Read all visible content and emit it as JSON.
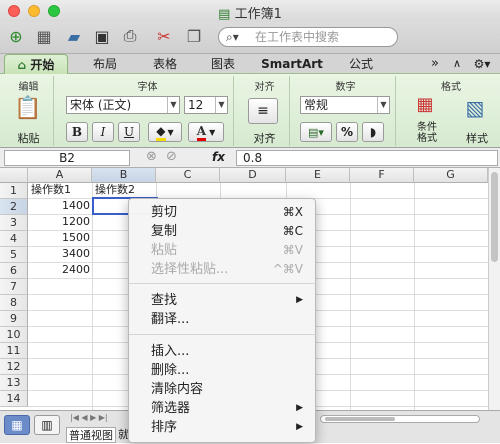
{
  "window": {
    "title": "工作簿1"
  },
  "toolbar": {
    "search_placeholder": "在工作表中搜索"
  },
  "tabs": [
    "开始",
    "布局",
    "表格",
    "图表",
    "SmartArt",
    "公式"
  ],
  "ribbon": {
    "groups": {
      "edit": "编辑",
      "font": "字体",
      "align": "对齐",
      "number": "数字",
      "format": "格式"
    },
    "paste": "粘贴",
    "font_name": "宋体 (正文)",
    "font_size": "12",
    "bold": "B",
    "italic": "I",
    "underline": "U",
    "font_color": "A",
    "align_label": "对齐",
    "number_format": "常规",
    "percent": "%",
    "cond_format": "条件\n格式",
    "style": "样式"
  },
  "formula_bar": {
    "name_box": "B2",
    "fx": "fx",
    "value": "0.8"
  },
  "sheet": {
    "columns": [
      "A",
      "B",
      "C",
      "D",
      "E",
      "F",
      "G"
    ],
    "rows": [
      "1",
      "2",
      "3",
      "4",
      "5",
      "6",
      "7",
      "8",
      "9",
      "10",
      "11",
      "12",
      "13",
      "14"
    ],
    "cells": {
      "A1": "操作数1",
      "B1": "操作数2",
      "A2": "1400",
      "A3": "1200",
      "A4": "1500",
      "A5": "3400",
      "A6": "2400"
    }
  },
  "bottom": {
    "view_normal": "普通视图",
    "view_page": "就"
  },
  "context_menu": {
    "items": [
      {
        "label": "剪切",
        "shortcut": "⌘X",
        "disabled": false
      },
      {
        "label": "复制",
        "shortcut": "⌘C",
        "disabled": false
      },
      {
        "label": "粘贴",
        "shortcut": "⌘V",
        "disabled": true
      },
      {
        "label": "选择性粘贴...",
        "shortcut": "^⌘V",
        "disabled": true
      },
      {
        "label": "查找",
        "shortcut": "▶",
        "disabled": false
      },
      {
        "label": "翻译...",
        "shortcut": "",
        "disabled": false
      },
      {
        "label": "插入...",
        "shortcut": "",
        "disabled": false
      },
      {
        "label": "删除...",
        "shortcut": "",
        "disabled": false
      },
      {
        "label": "清除内容",
        "shortcut": "",
        "disabled": false
      },
      {
        "label": "筛选器",
        "shortcut": "▶",
        "disabled": false
      },
      {
        "label": "排序",
        "shortcut": "▶",
        "disabled": false
      }
    ]
  }
}
